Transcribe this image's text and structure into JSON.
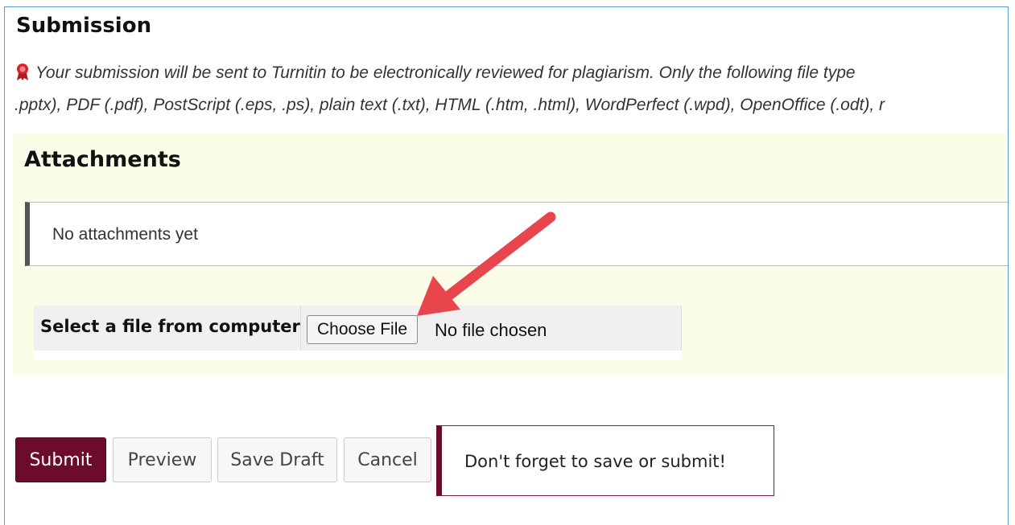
{
  "section": {
    "title": "Submission",
    "notice_line1": "Your submission will be sent to Turnitin to be electronically reviewed for plagiarism. Only the following file type",
    "notice_line2": ".pptx), PDF (.pdf), PostScript (.eps, .ps), plain text (.txt), HTML (.htm, .html), WordPerfect (.wpd), OpenOffice (.odt), r"
  },
  "attachments": {
    "title": "Attachments",
    "empty_text": "No attachments yet",
    "file_label": "Select a file from computer",
    "choose_button": "Choose File",
    "file_status": "No file chosen"
  },
  "actions": {
    "submit": "Submit",
    "preview": "Preview",
    "save_draft": "Save Draft",
    "cancel": "Cancel"
  },
  "reminder": {
    "text": "Don't forget to save or submit!"
  },
  "colors": {
    "accent": "#6b0d2a",
    "panel_bg": "#fbfde9",
    "arrow": "#e8454c"
  },
  "icons": {
    "notice": "turnitin-ribbon-icon",
    "annotation": "arrow-annotation"
  }
}
